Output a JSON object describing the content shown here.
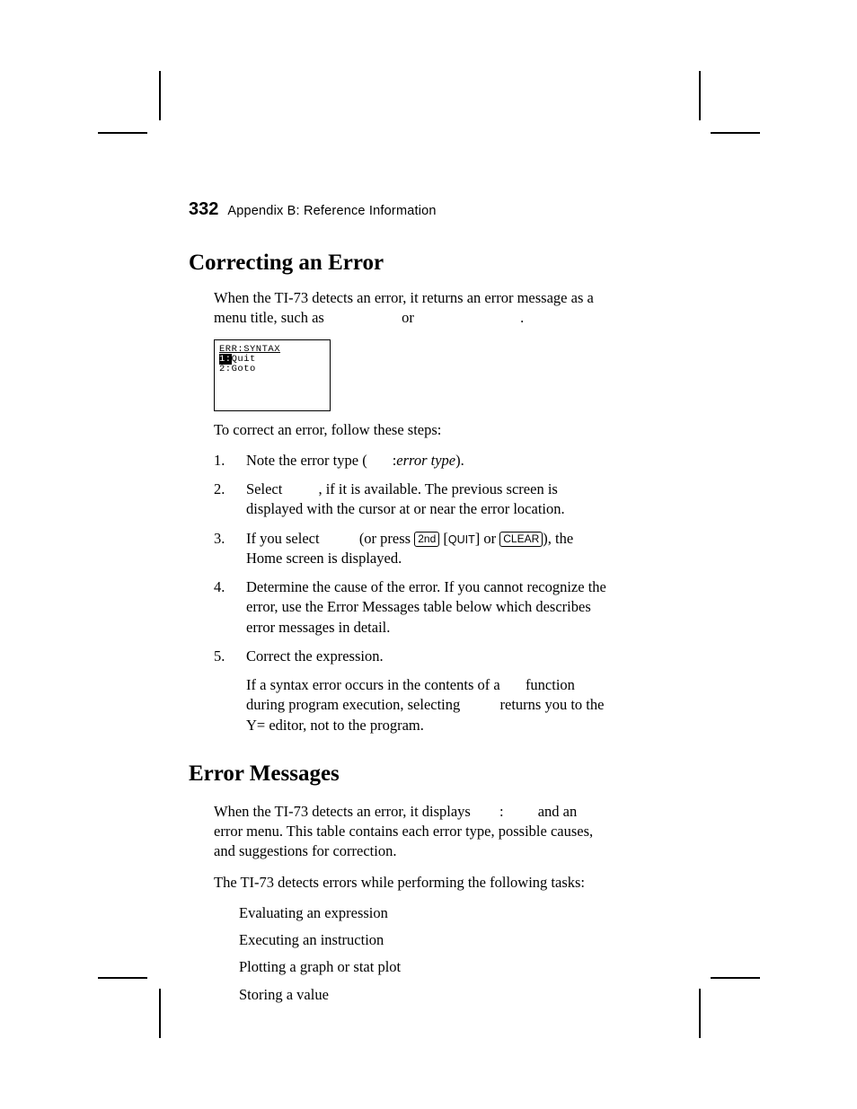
{
  "header": {
    "page_number": "332",
    "text": "Appendix B: Reference Information"
  },
  "section1": {
    "title": "Correcting an Error",
    "intro_a": "When the TI-73 detects an error, it returns an error message as a menu title, such as ",
    "intro_b": " or ",
    "intro_c": ".",
    "screenshot": {
      "line1": "ERR:SYNTAX",
      "line2a": "1:",
      "line2b": "Quit",
      "line3": "2:Goto"
    },
    "steps_intro": "To correct an error, follow these steps:",
    "steps": [
      {
        "n": "1.",
        "a": "Note the error type (",
        "b": ":",
        "c": "error type",
        "d": ")."
      },
      {
        "n": "2.",
        "a": "Select ",
        "b": ", if it is available. The previous screen is displayed with the cursor at or near the error location."
      },
      {
        "n": "3.",
        "a": "If you select ",
        "b": " (or press ",
        "k1": "2nd",
        "k2": "QUIT",
        "mid": " [",
        "close1": "]",
        "or": " or ",
        "k3": "CLEAR",
        "c": "), the Home screen is displayed."
      },
      {
        "n": "4.",
        "a": "Determine the cause of the error. If you cannot recognize the error, use the Error Messages table below which describes error messages in detail."
      },
      {
        "n": "5.",
        "a": "Correct the expression.",
        "sub_a": "If a syntax error occurs in the contents of a ",
        "sub_b": " function during program execution, selecting ",
        "sub_c": " returns you to the Y= editor, not to the program."
      }
    ]
  },
  "section2": {
    "title": "Error Messages",
    "p1_a": "When the TI-73 detects an error, it displays ",
    "p1_b": ":",
    "p1_c": " and an error menu. This table contains each error type, possible causes, and suggestions for correction.",
    "p2": "The TI-73 detects errors while performing the following tasks:",
    "bullets": [
      "Evaluating an expression",
      "Executing an instruction",
      "Plotting a graph or stat plot",
      "Storing a value"
    ]
  }
}
